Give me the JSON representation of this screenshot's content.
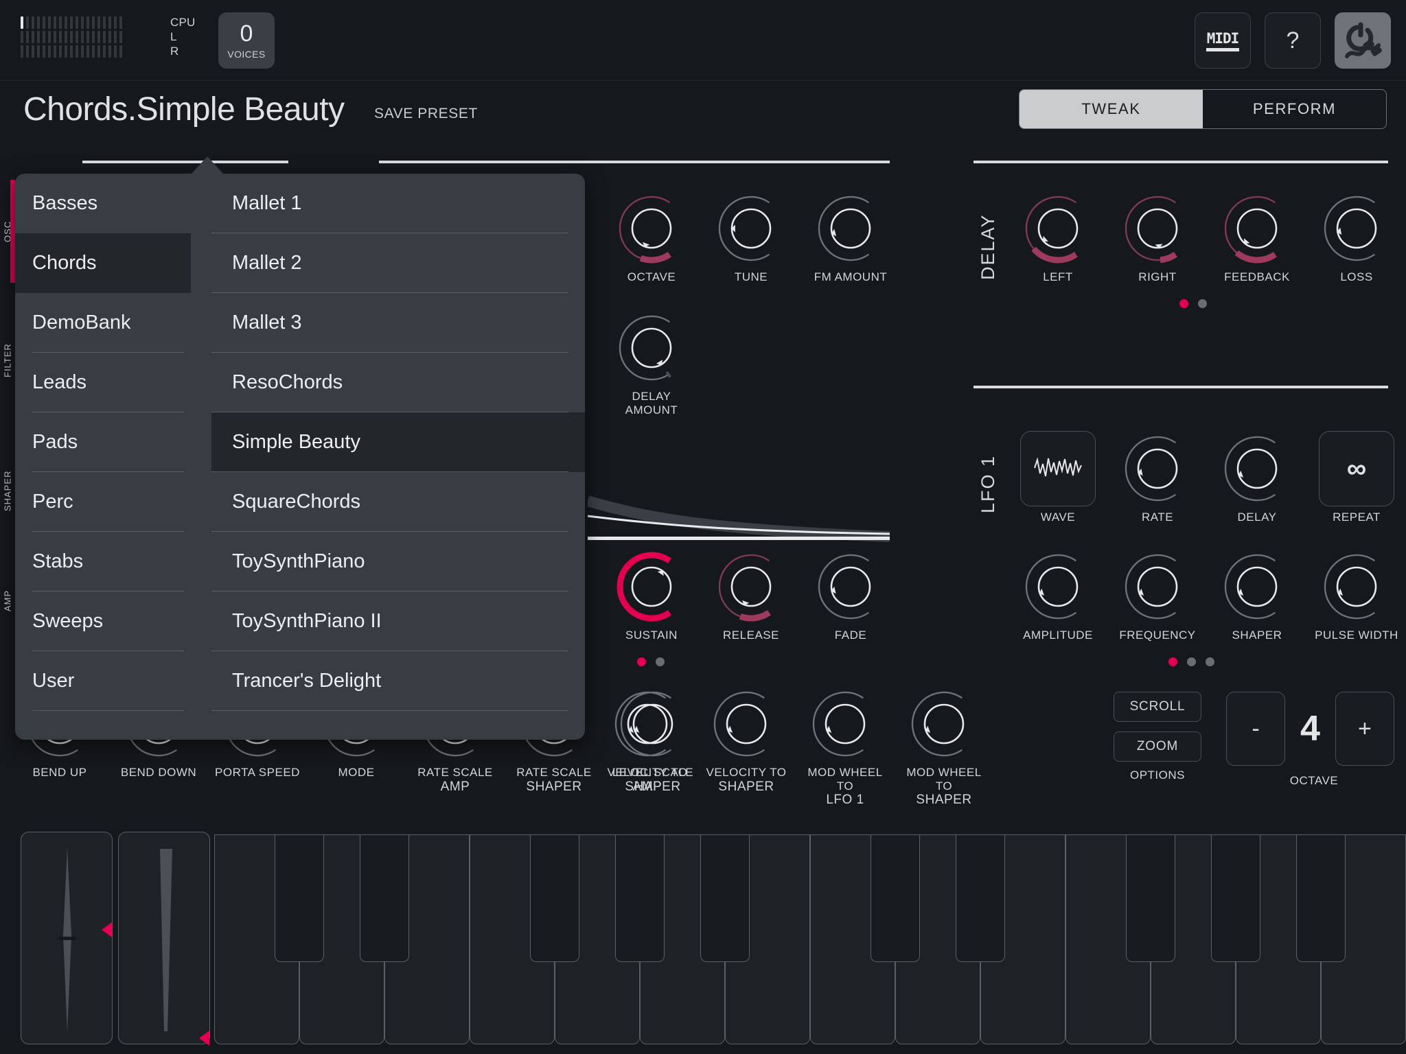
{
  "topbar": {
    "meters": [
      {
        "name": "CPU",
        "lit": 1,
        "total": 19
      },
      {
        "name": "L",
        "lit": 0,
        "total": 19
      },
      {
        "name": "R",
        "lit": 0,
        "total": 19
      }
    ],
    "voices": {
      "count": "0",
      "label": "VOICES"
    },
    "buttons": {
      "midi": "MIDI",
      "help": "?",
      "power": "power-cable"
    }
  },
  "header": {
    "preset_title": "Chords.Simple Beauty",
    "save_preset": "SAVE PRESET",
    "mode_tabs": [
      {
        "label": "TWEAK",
        "active": true
      },
      {
        "label": "PERFORM",
        "active": false
      }
    ]
  },
  "browser": {
    "categories": [
      {
        "label": "Basses",
        "selected": false
      },
      {
        "label": "Chords",
        "selected": true
      },
      {
        "label": "DemoBank",
        "selected": false
      },
      {
        "label": "Leads",
        "selected": false
      },
      {
        "label": "Pads",
        "selected": false
      },
      {
        "label": "Perc",
        "selected": false
      },
      {
        "label": "Stabs",
        "selected": false
      },
      {
        "label": "Sweeps",
        "selected": false
      },
      {
        "label": "User",
        "selected": false
      }
    ],
    "presets": [
      {
        "label": "Mallet 1",
        "selected": false
      },
      {
        "label": "Mallet 2",
        "selected": false
      },
      {
        "label": "Mallet 3",
        "selected": false
      },
      {
        "label": "ResoChords",
        "selected": false
      },
      {
        "label": "Simple Beauty",
        "selected": true
      },
      {
        "label": "SquareChords",
        "selected": false
      },
      {
        "label": "ToySynthPiano",
        "selected": false
      },
      {
        "label": "ToySynthPiano II",
        "selected": false
      },
      {
        "label": "Trancer's Delight",
        "selected": false
      }
    ]
  },
  "side_tabs": [
    {
      "label": "OSC",
      "accent": "#e4004e"
    },
    {
      "label": "FILTER",
      "accent": ""
    },
    {
      "label": "SHAPER",
      "accent": ""
    },
    {
      "label": "AMP",
      "accent": ""
    }
  ],
  "osc_section": {
    "knobs": [
      {
        "label": "OCTAVE",
        "value": 0.22,
        "tone": "dim"
      },
      {
        "label": "TUNE",
        "value": 0.5,
        "tone": "off"
      },
      {
        "label": "FM AMOUNT",
        "value": 0.44,
        "tone": "off"
      },
      {
        "label": "DELAY AMOUNT",
        "value": 0.02,
        "tone": "grey"
      }
    ]
  },
  "env_section": {
    "knobs": [
      {
        "label": "SUSTAIN",
        "value": 1.0,
        "tone": "hot"
      },
      {
        "label": "RELEASE",
        "value": 0.22,
        "tone": "dim"
      },
      {
        "label": "FADE",
        "value": 0.45,
        "tone": "off"
      }
    ],
    "dots": [
      true,
      false
    ]
  },
  "delay_section": {
    "title": "DELAY",
    "knobs": [
      {
        "label": "LEFT",
        "value": 0.34,
        "tone": "dim"
      },
      {
        "label": "RIGHT",
        "value": 0.12,
        "tone": "dim"
      },
      {
        "label": "FEEDBACK",
        "value": 0.3,
        "tone": "dim"
      },
      {
        "label": "LOSS",
        "value": 0.46,
        "tone": "off"
      }
    ],
    "dots": [
      true,
      false
    ]
  },
  "lfo_section": {
    "title": "LFO 1",
    "controls": [
      {
        "label": "WAVE",
        "kind": "wave-button",
        "icon": "random-wave-icon"
      },
      {
        "label": "RATE",
        "kind": "knob",
        "value": 0.45,
        "tone": "off"
      },
      {
        "label": "DELAY",
        "kind": "knob",
        "value": 0.42,
        "tone": "off"
      },
      {
        "label": "REPEAT",
        "kind": "repeat-button",
        "icon": "infinity-icon",
        "value": "∞"
      }
    ]
  },
  "lfo_dest_section": {
    "knobs": [
      {
        "label": "AMPLITUDE",
        "value": 0.42,
        "tone": "off"
      },
      {
        "label": "FREQUENCY",
        "value": 0.42,
        "tone": "off"
      },
      {
        "label": "SHAPER",
        "value": 0.42,
        "tone": "off"
      },
      {
        "label": "PULSE WIDTH",
        "value": 0.42,
        "tone": "off"
      }
    ],
    "dots": [
      true,
      false,
      false
    ]
  },
  "bottom_row": {
    "knobs": [
      {
        "line1": "BEND UP",
        "line2": "",
        "value": 0.42,
        "tone": "off"
      },
      {
        "line1": "BEND DOWN",
        "line2": "",
        "value": 0.42,
        "tone": "off"
      },
      {
        "line1": "PORTA SPEED",
        "line2": "",
        "value": 0.42,
        "tone": "off"
      },
      {
        "line1": "MODE",
        "line2": "",
        "value": 0.42,
        "tone": "off"
      },
      {
        "line1": "RATE SCALE",
        "line2": "AMP",
        "value": 0.42,
        "tone": "off"
      },
      {
        "line1": "RATE SCALE",
        "line2": "SHAPER",
        "value": 0.42,
        "tone": "off"
      },
      {
        "line1": "LEVEL SCALE",
        "line2": "SHAPER",
        "value": 0.42,
        "tone": "off"
      },
      {
        "line1": "VELOCITY TO",
        "line2": "AMP",
        "value": 0.42,
        "tone": "off"
      },
      {
        "line1": "VELOCITY TO",
        "line2": "SHAPER",
        "value": 0.42,
        "tone": "off"
      },
      {
        "line1": "MOD WHEEL TO",
        "line2": "LFO 1",
        "value": 0.42,
        "tone": "off"
      },
      {
        "line1": "MOD WHEEL TO",
        "line2": "SHAPER",
        "value": 0.42,
        "tone": "off"
      }
    ],
    "options": {
      "label": "OPTIONS",
      "scroll": "SCROLL",
      "zoom": "ZOOM"
    },
    "octave": {
      "label": "OCTAVE",
      "minus": "-",
      "value": "4",
      "plus": "+"
    }
  },
  "keyboard": {
    "pitch_wheel": "pitch-bend",
    "mod_wheel": "mod-wheel",
    "white_keys": 14,
    "black_pattern": [
      1,
      1,
      0,
      1,
      1,
      1,
      0
    ]
  },
  "colors": {
    "accent": "#e4004e",
    "accent_dim": "#9e3a5e",
    "bg": "#15181c",
    "panel": "#383d43",
    "ring": "#6e7278"
  }
}
